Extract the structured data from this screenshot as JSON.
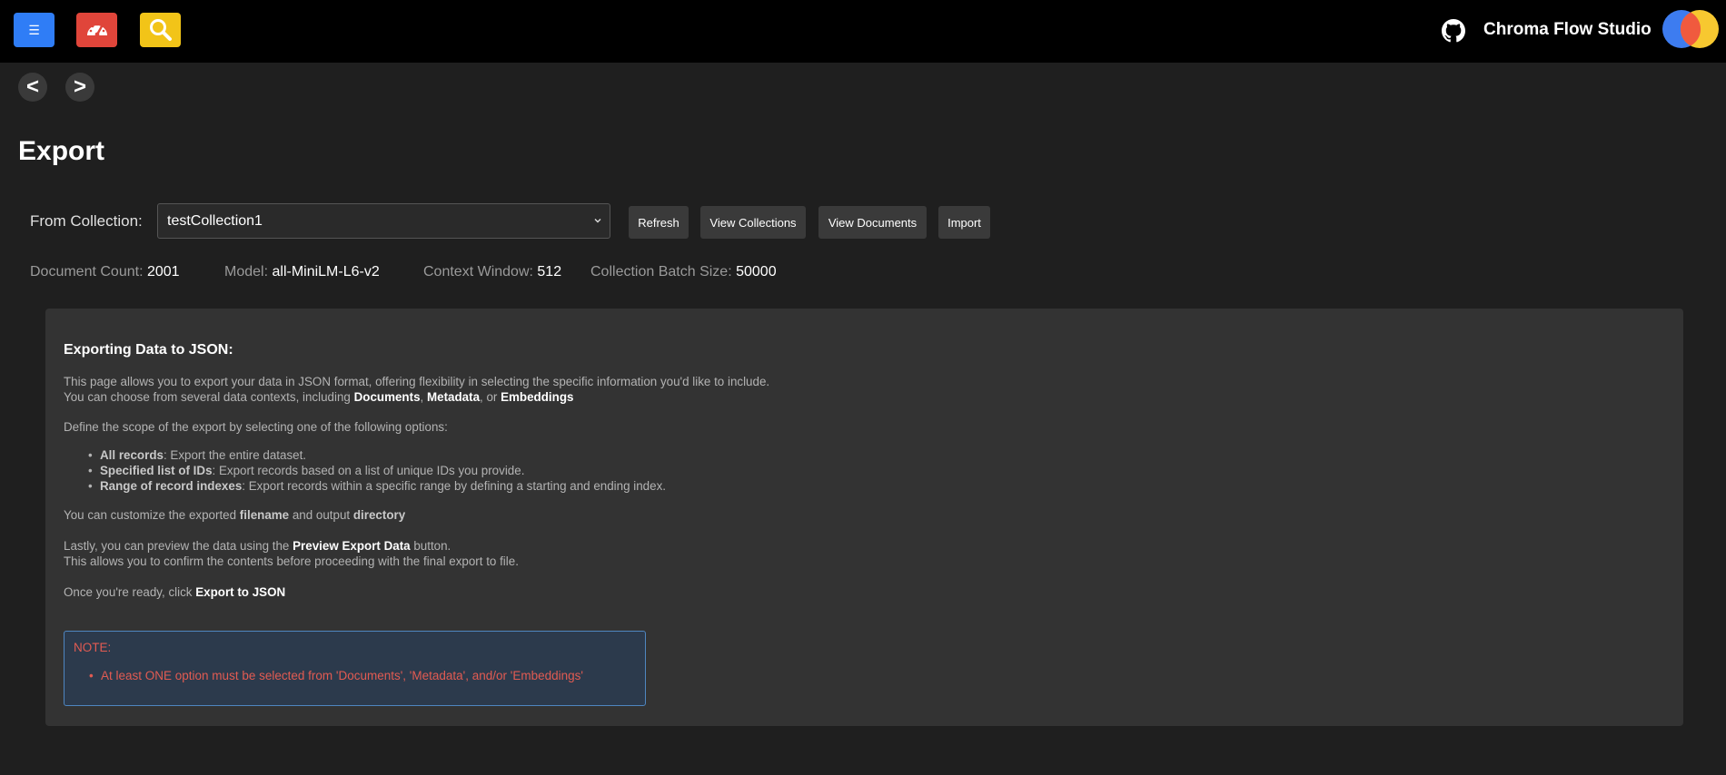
{
  "topbar": {
    "menu_glyph": "☰",
    "app_title": "Chroma Flow Studio",
    "icons": [
      "menu-icon",
      "dashboard-icon",
      "search-icon",
      "github-icon",
      "chroma-logo-icon"
    ],
    "colors": {
      "menu": "#2f7df6",
      "dashboard": "#e0453a",
      "search": "#f2c418"
    }
  },
  "nav": {
    "back": "<",
    "forward": ">"
  },
  "page": {
    "title": "Export"
  },
  "collection": {
    "label": "From Collection:",
    "selected": "testCollection1",
    "buttons": {
      "refresh": "Refresh",
      "view_collections": "View Collections",
      "view_documents": "View Documents",
      "import": "Import"
    }
  },
  "stats": {
    "doc_count_label": "Document Count:",
    "doc_count": "2001",
    "model_label": "Model:",
    "model": "all-MiniLM-L6-v2",
    "context_label": "Context Window:",
    "context": "512",
    "batch_label": "Collection Batch Size:",
    "batch": "50000"
  },
  "info": {
    "heading": "Exporting Data to JSON:",
    "p1a": "This page allows you to export your data in JSON format, offering flexibility in selecting the specific information you'd like to include.",
    "p1b": "You can choose from several data contexts, including ",
    "ctx_documents": "Documents",
    "sep1": ", ",
    "ctx_metadata": "Metadata",
    "sep2": ", or ",
    "ctx_embeddings": "Embeddings",
    "p2": "Define the scope of the export by selecting one of the following options:",
    "options": [
      {
        "name": "All records",
        "desc": ": Export the entire dataset."
      },
      {
        "name": "Specified list of IDs",
        "desc": ": Export records based on a list of unique IDs you provide."
      },
      {
        "name": "Range of record indexes",
        "desc": ": Export records within a specific range by defining a starting and ending index."
      }
    ],
    "p3a": "You can customize the exported ",
    "p3_filename": "filename",
    "p3b": " and output ",
    "p3_directory": "directory",
    "p4a": "Lastly, you can preview the data using the ",
    "p4_btn": "Preview Export Data",
    "p4b": " button.",
    "p4c": "This allows you to confirm the contents before proceeding with the final export to file.",
    "p5a": "Once you're ready, click ",
    "p5_btn": "Export to JSON",
    "note_title": "NOTE:",
    "note_item": "At least ONE option must be selected from 'Documents', 'Metadata', and/or 'Embeddings'"
  }
}
